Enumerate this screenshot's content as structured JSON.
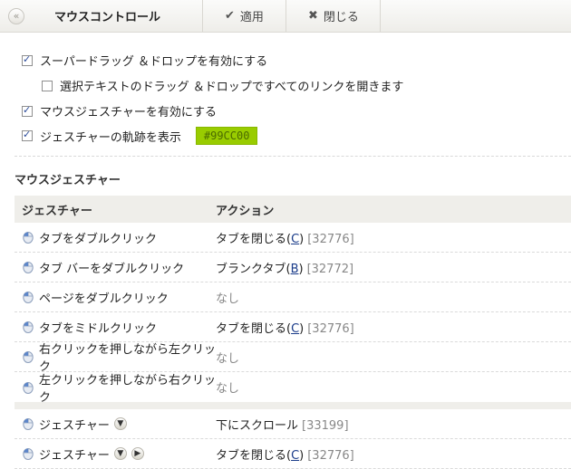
{
  "toolbar": {
    "back_icon": "double-chevron-left-icon",
    "title": "マウスコントロール",
    "apply_label": "適用",
    "close_label": "閉じる"
  },
  "options": [
    {
      "label": "スーパードラッグ ＆ドロップを有効にする",
      "checked": true
    },
    {
      "label": "選択テキストのドラッグ ＆ドロップですべてのリンクを開きます",
      "checked": false
    },
    {
      "label": "マウスジェスチャーを有効にする",
      "checked": true
    },
    {
      "label": "ジェスチャーの軌跡を表示",
      "checked": true
    }
  ],
  "trail_color": "#99CC00",
  "section_title": "マウスジェスチャー",
  "table": {
    "headers": [
      "ジェスチャー",
      "アクション"
    ],
    "rows": [
      {
        "gesture": "タブをダブルクリック",
        "action": "タブを閉じる(",
        "key": "C",
        "close": ")",
        "code": "[32776]"
      },
      {
        "gesture": "タブ バーをダブルクリック",
        "action": "ブランクタブ(",
        "key": "B",
        "close": ")",
        "code": "[32772]"
      },
      {
        "gesture": "ページをダブルクリック",
        "action": "なし"
      },
      {
        "gesture": "タブをミドルクリック",
        "action": "タブを閉じる(",
        "key": "C",
        "close": ")",
        "code": "[32776]"
      },
      {
        "gesture": "右クリックを押しながら左クリック",
        "action": "なし"
      },
      {
        "gesture": "左クリックを押しながら右クリック",
        "action": "なし"
      },
      {
        "gesture": "ジェスチャー",
        "action": "下にスクロール",
        "code": "[33199]"
      },
      {
        "gesture": "ジェスチャー",
        "action": "タブを閉じる(",
        "key": "C",
        "close": ")",
        "code": "[32776]"
      }
    ]
  }
}
